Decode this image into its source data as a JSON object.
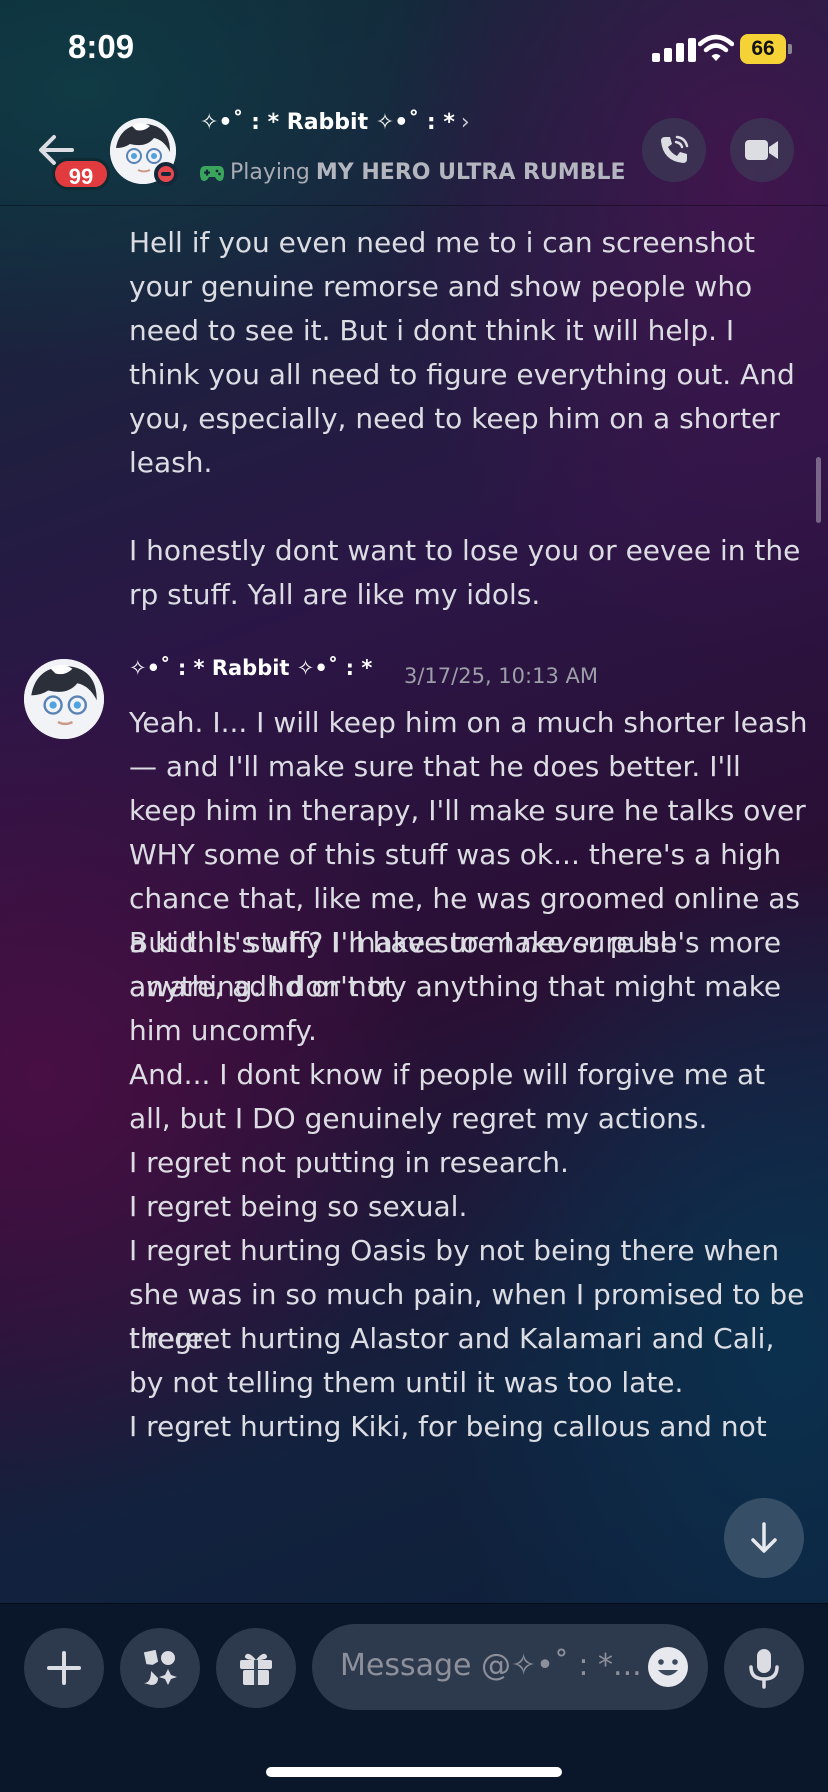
{
  "status_bar": {
    "time": "8:09",
    "battery": "66"
  },
  "header": {
    "unread_count": "99",
    "name": "✧•˚ : * Rabbit ✧•˚ : *",
    "chevron": "›",
    "activity_prefix": "Playing",
    "activity_game": "MY HERO ULTRA RUMBLE",
    "status": "do-not-disturb"
  },
  "messages": {
    "prev_paragraph_1": "Hell if you even need me to i can screenshot your genuine remorse and show people who need to see it. But i dont think it will help. I think you all need to figure everything out. And you, especially, need to keep him on a shorter leash.",
    "prev_paragraph_2": "I honestly dont want to lose you or eevee in the rp stuff. Yall are like my idols.",
    "author": "✧•˚ : * Rabbit ✧•˚ : *",
    "timestamp": "3/17/25, 10:13 AM",
    "body_1a": "Yeah. I... I will keep him on a much shorter leash— and I'll make sure that he does better. I'll keep him in therapy, I'll make sure he talks over WHY some of this stuff was ok... there's a high chance that, like me, he was groomed online as a kid. It's why I make sure I ",
    "body_1_em": "never",
    "body_1b": " push anything. I don't try anything that might make him uncomfy.",
    "body_2": "But this stuff? I'll have to make sure he's more aware, adhd or not.",
    "body_3": "And... I dont know if people will forgive me at all, but I DO genuinely regret my actions.",
    "body_4": "I regret not putting in research.",
    "body_5": "I regret being so sexual.",
    "body_6": "I regret hurting Oasis by not being there when she was in so much pain, when I promised to be there.",
    "body_7": "I regret hurting Alastor and Kalamari and Cali, by not telling them until it was too late.",
    "body_8": "I regret hurting Kiki, for being callous and not"
  },
  "composer": {
    "placeholder": "Message @✧•˚ : *..."
  },
  "colors": {
    "accent_red": "#e23b3f",
    "battery_yellow": "#f5d235",
    "game_green": "#3ba55d"
  },
  "icons": [
    "back-arrow-icon",
    "phone-call-icon",
    "video-camera-icon",
    "plus-icon",
    "apps-icon",
    "gift-icon",
    "emoji-icon",
    "microphone-icon",
    "arrow-down-icon",
    "gamepad-icon"
  ]
}
